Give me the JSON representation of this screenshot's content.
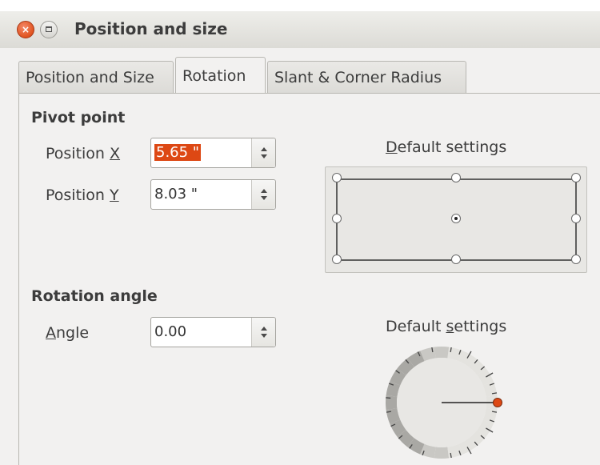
{
  "window": {
    "title": "Position and size",
    "close_glyph": "×"
  },
  "tabs": [
    {
      "label": "Position and Size",
      "active": false
    },
    {
      "label": "Rotation",
      "active": true
    },
    {
      "label": "Slant & Corner Radius",
      "active": false
    }
  ],
  "pivot": {
    "heading": "Pivot point",
    "pos_x": {
      "label_pre": "Position ",
      "label_key": "X",
      "value": "5.65 \""
    },
    "pos_y": {
      "label_pre": "Position ",
      "label_key": "Y",
      "value": "8.03 \""
    },
    "defaults_label_key": "D",
    "defaults_label_rest": "efault settings",
    "selected_point": "center"
  },
  "rotation": {
    "heading": "Rotation angle",
    "angle_label_key": "A",
    "angle_label_rest": "ngle",
    "angle_value": "0.00",
    "defaults_label_pre": "Default ",
    "defaults_label_key": "s",
    "defaults_label_rest": "ettings",
    "dial_angle_deg": 0
  },
  "colors": {
    "accent": "#dd4814",
    "dialog_bg": "#f2f1f0"
  }
}
